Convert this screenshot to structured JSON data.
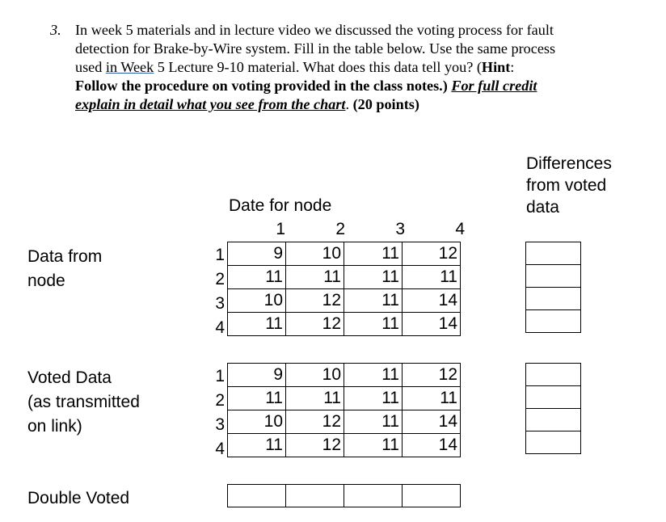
{
  "question": {
    "number": "3.",
    "lines": [
      "In week 5 materials and in lecture video we discussed the voting process for fault",
      "detection for Brake-by-Wire system. Fill in the table below. Use the same process"
    ],
    "line3_pre": "used ",
    "line3_link": "in  Week",
    "line3_post": " 5 Lecture 9-10 material. What does this data tell you? (",
    "line3_hint": "Hint",
    "line3_end": ":",
    "line4_bold": "Follow the procedure on voting provided in the class notes.)",
    "line4_emph": "For full credit",
    "line5_emph": "explain in detail what you see from the chart",
    "line5_post": ".  ",
    "line5_points": "(20 points)"
  },
  "table_title": "Date for node",
  "column_headers": [
    "1",
    "2",
    "3",
    "4"
  ],
  "row_headers": [
    "1",
    "2",
    "3",
    "4"
  ],
  "sections": {
    "data_from_node": {
      "label_line1": "Data from",
      "label_line2": "node"
    },
    "voted_data": {
      "label_line1": "Voted Data",
      "label_line2": "(as transmitted",
      "label_line3": "on link)"
    },
    "double_voted": {
      "label": "Double Voted"
    }
  },
  "differences_header": {
    "line1": "Differences",
    "line2": "from voted",
    "line3": "data"
  },
  "data_from_node_rows": [
    [
      "9",
      "10",
      "11",
      "12"
    ],
    [
      "11",
      "11",
      "11",
      "11"
    ],
    [
      "10",
      "12",
      "11",
      "14"
    ],
    [
      "11",
      "12",
      "11",
      "14"
    ]
  ],
  "voted_data_rows": [
    [
      "9",
      "10",
      "11",
      "12"
    ],
    [
      "11",
      "11",
      "11",
      "11"
    ],
    [
      "10",
      "12",
      "11",
      "14"
    ],
    [
      "11",
      "12",
      "11",
      "14"
    ]
  ],
  "double_voted_row": [
    "",
    "",
    "",
    ""
  ],
  "differences_node": [
    "",
    "",
    "",
    ""
  ],
  "differences_voted": [
    "",
    "",
    "",
    ""
  ]
}
